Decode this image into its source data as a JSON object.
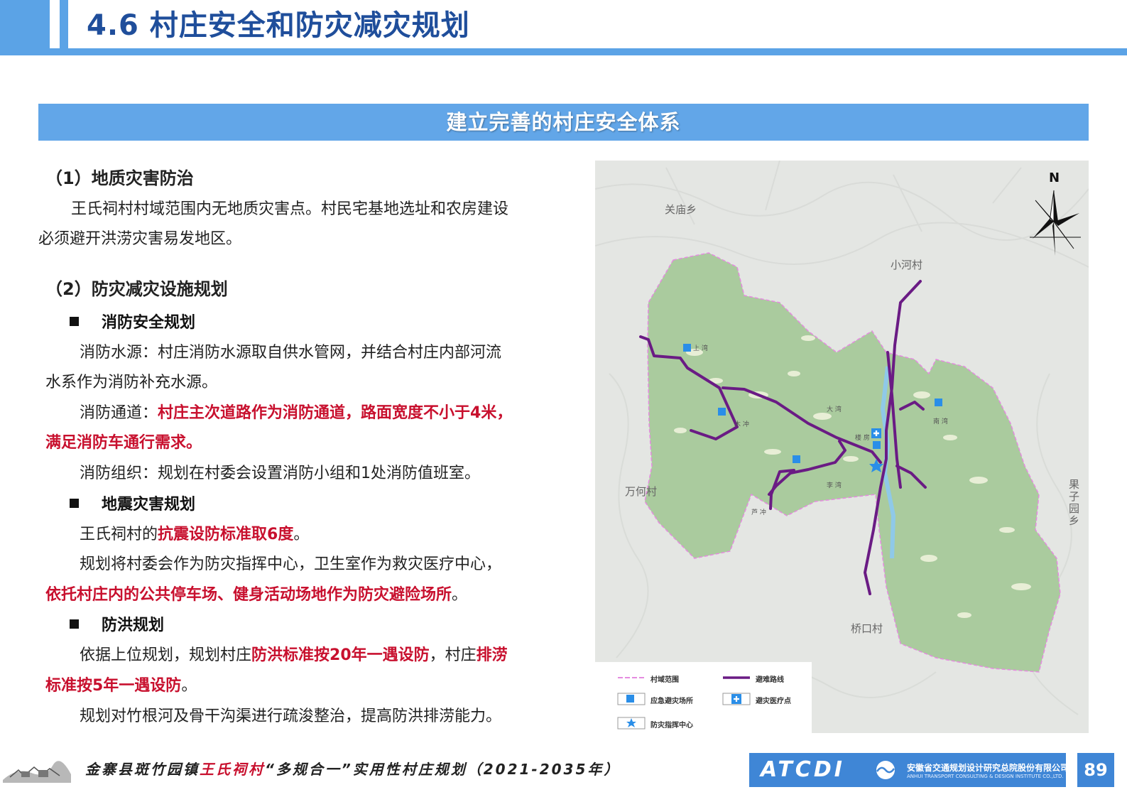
{
  "header": {
    "title": "4.6 村庄安全和防灾减灾规划"
  },
  "banner": {
    "title": "建立完善的村庄安全体系"
  },
  "content": {
    "s1": {
      "heading": "（1）地质灾害防治",
      "l1": "王氏祠村村域范围内无地质灾害点。村民宅基地选址和农房建设",
      "l2": "必须避开洪涝灾害易发地区。"
    },
    "s2": {
      "heading": "（2）防灾减灾设施规划"
    },
    "fire": {
      "heading": "消防安全规划",
      "src_l1": "消防水源：村庄消防水源取自供水管网，并结合村庄内部河流",
      "src_l2": "水系作为消防补充水源。",
      "road_label": "消防通道：",
      "road_red_l1": "村庄主次道路作为消防通道，路面宽度不小于4米，",
      "road_red_l2": "满足消防车通行需求。",
      "org": "消防组织：规划在村委会设置消防小组和1处消防值班室。"
    },
    "quake": {
      "heading": "地震灾害规划",
      "std_pre": "王氏祠村的",
      "std_red": "抗震设防标准取6度",
      "std_post": "。",
      "plan_l1": "规划将村委会作为防灾指挥中心，卫生室作为救灾医疗中心，",
      "plan_red": "依托村庄内的公共停车场、健身活动场地作为防灾避险场所",
      "plan_post": "。"
    },
    "flood": {
      "heading": "防洪规划",
      "l1_pre": "依据上位规划，规划村庄",
      "l1_red1": "防洪标准按20年一遇设防",
      "l1_mid": "，村庄",
      "l1_red2": "排涝",
      "l2_red": "标准按5年一遇设防",
      "l2_post": "。",
      "l3": "规划对竹根河及骨干沟渠进行疏浚整治，提高防洪排涝能力。"
    }
  },
  "map": {
    "labels": {
      "guanmiao": "关庙乡",
      "xiaohe": "小河村",
      "wanhe": "万何村",
      "guoziyuan": "果子园乡",
      "qiaokou": "桥口村",
      "north": "N"
    },
    "villages": {
      "shangwan": "上 湾",
      "muchong": "木 冲",
      "dawan": "大 湾",
      "loufang": "楼 房",
      "nanwan": "南 湾",
      "liwan": "李 湾",
      "luchong": "芦 冲"
    },
    "legend": {
      "boundary": "村域范围",
      "route": "避难路线",
      "shelter": "应急避灾场所",
      "medical": "避灾医疗点",
      "command": "防灾指挥中心"
    },
    "colors": {
      "village_area": "#aacb9e",
      "route": "#6a1b84",
      "boundary": "#e58be0",
      "marker": "#2a8ee8"
    }
  },
  "footer": {
    "title_pre": "金寨县斑竹园镇",
    "title_village": "王氏祠村",
    "title_post": "“多规合一”实用性村庄规划（2021-2035年）",
    "logo_text": "ATCDI",
    "company_cn": "安徽省交通规划设计研究总院股份有限公司",
    "company_en": "ANHUI TRANSPORT CONSULTING & DESIGN INSTITUTE CO.,LTD.",
    "page": "89"
  }
}
